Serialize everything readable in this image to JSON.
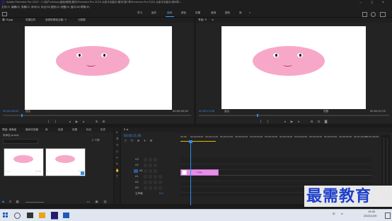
{
  "title_bar": {
    "text": "Adobe Premiere Pro 2020 - C:\\用户\\cfshuo\\桌面\\教程\\素材\\Premiere Pro 2020 从新手到高手\\素材\\第7章\\Premiere Pro 2020 从新手到高手\\第6章\\...",
    "controls": [
      "—",
      "□",
      "✕"
    ]
  },
  "menu": [
    "文件(F)",
    "编辑(E)",
    "剪辑(C)",
    "序列(S)",
    "标记(M)",
    "图形(G)",
    "视图(V)",
    "窗口(W)",
    "帮助(H)"
  ],
  "workspaces": [
    "学习",
    "组件",
    "编辑",
    "颜色",
    "效果",
    "音频",
    "图形",
    "库",
    "»"
  ],
  "source_monitor": {
    "tabs": [
      "源: 5.jpg",
      "效果控件",
      "音频剪辑混合器: 5",
      "元数据"
    ],
    "timecode": "00;00;00;00",
    "fit": "适合",
    "duration": "00;00;05;00"
  },
  "program_monitor": {
    "tabs": [
      "节目: 5",
      "≡"
    ],
    "timecode": "00;00;11;06",
    "fit": "适合",
    "quality": "完整",
    "duration": "00;00;07;05"
  },
  "project_panel": {
    "tabs": [
      "项目: 未命名",
      "媒体浏览器",
      "库",
      "信息",
      "效果",
      "标记",
      "历史"
    ],
    "search_placeholder": "",
    "items_count": "2 个项",
    "breadcrumb": "未命名.prproj",
    "items": [
      {
        "name": "5.jpg",
        "duration": "5;00"
      },
      {
        "name": "5",
        "duration": "7;05"
      }
    ]
  },
  "timeline": {
    "tab": "5 ≡",
    "timecode": "00;00;11;06",
    "ruler_ticks": [
      "00;00",
      "00;00;05;00",
      "00;00;10;00",
      "00;00;15;00",
      "00;00;20;00",
      "00;00;25;00",
      "00;00;30;00",
      "00;00;35;00",
      "00;00;40;00",
      "00;00;45;00",
      "00;00;50;00",
      "00;00;55;00",
      "00;01;00;00",
      "00;01;05;00"
    ],
    "tracks": [
      {
        "name": "V3",
        "target": false
      },
      {
        "name": "V2",
        "target": false
      },
      {
        "name": "V1",
        "target": true
      },
      {
        "name": "A1",
        "target": false
      },
      {
        "name": "A2",
        "target": false
      },
      {
        "name": "A3",
        "target": false
      },
      {
        "name": "主声道",
        "target": false
      }
    ],
    "master_value": "0.0",
    "clip_label": "5.jpg"
  },
  "watermark": "最需教育",
  "taskbar": {
    "time": "19:42",
    "date": "2022/1/20",
    "lang": "中",
    "volume": "⊳"
  },
  "colors": {
    "accent": "#2d8ceb",
    "clip": "#e58ee7",
    "face": "#f7a8c9",
    "watermark": "#1f3fcc"
  }
}
